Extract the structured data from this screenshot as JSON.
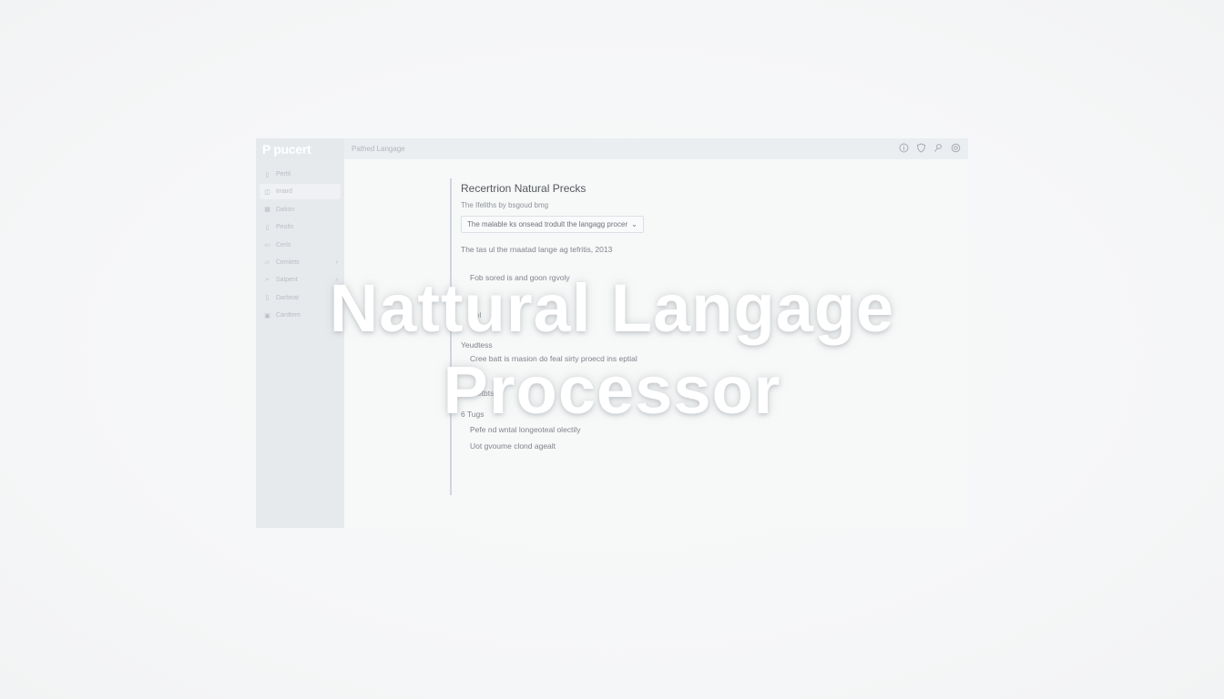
{
  "app": {
    "logo": "P pucert",
    "breadcrumb": "Pathed Langage"
  },
  "topbar": {
    "icons": [
      "info-icon",
      "shield-icon",
      "user-icon",
      "settings-icon"
    ]
  },
  "sidebar": {
    "items": [
      {
        "label": "Pertit",
        "icon": "file-icon"
      },
      {
        "label": "Imard",
        "icon": "layers-icon",
        "active": true
      },
      {
        "label": "Dation",
        "icon": "grid-icon"
      },
      {
        "label": "Peolts",
        "icon": "doc-icon"
      },
      {
        "label": "Cerls",
        "icon": "card-icon"
      },
      {
        "label": "Cemlets",
        "icon": "folder-icon",
        "chevron": true
      },
      {
        "label": "Salpent",
        "icon": "search-icon",
        "chevron": true
      },
      {
        "label": "Darbeat",
        "icon": "page-icon"
      },
      {
        "label": "Cardtem",
        "icon": "box-icon"
      }
    ]
  },
  "main": {
    "title": "Recertrion Natural Precks",
    "subtitle": "The Ifeliths by bsgoud bmg",
    "select_value": "The malable ks onsead trodult the langagg procer",
    "line1": "The tas ul the rnaatad lange ag tefritis, 2013",
    "line2": "Fob sored is and goon rgvoly",
    "line3": "Bol",
    "section1": "Yeudtess",
    "line4": "Cree batt is rnasion do feal sirty proecd ins eptial",
    "section2": "Preoetbts",
    "section3": "6 Tugs",
    "line5": "Pefe nd wntal longeoteal olectily",
    "line6": "Uot gvoume clond agealt"
  },
  "overlay": {
    "line1": "Nattural Langage",
    "line2": "Processor"
  }
}
